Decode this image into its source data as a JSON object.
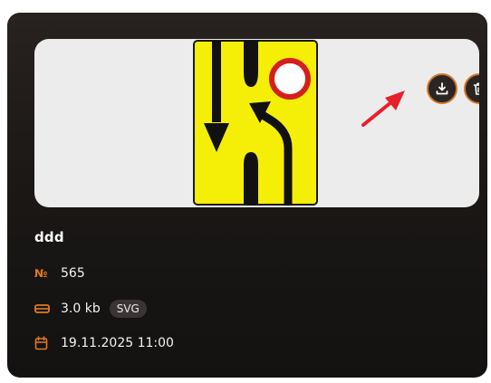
{
  "card": {
    "title": "ddd",
    "number_symbol": "№",
    "number": "565",
    "size": "3.0 kb",
    "format_badge": "SVG",
    "datetime": "19.11.2025 11:00"
  },
  "icons": {
    "download": "download-icon",
    "delete": "trash-icon",
    "number": "numero-icon",
    "size": "hard-drive-icon",
    "date": "calendar-icon"
  },
  "colors": {
    "accent": "#e07a22",
    "card_background": "#1b1816",
    "preview_background": "#ececec",
    "sign_yellow": "#f5ee06",
    "sign_red": "#d4201b",
    "annotation_arrow": "#e8202a"
  }
}
